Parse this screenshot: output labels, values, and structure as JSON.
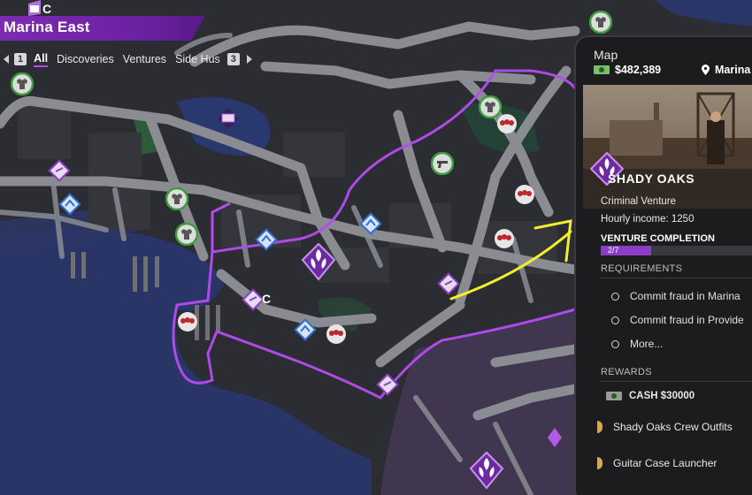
{
  "header": {
    "region_name": "Marina East",
    "logo_letter": "C"
  },
  "filters": {
    "left_key": "1",
    "tabs": [
      "All",
      "Discoveries",
      "Ventures",
      "Side Hus"
    ],
    "right_key": "3"
  },
  "map_labels": {
    "property_letter": "C"
  },
  "panel": {
    "title": "Map",
    "cash": "$482,389",
    "location": "Marina",
    "venture_name": "SHADY OAKS",
    "venture_type": "Criminal Venture",
    "hourly_income": "Hourly income: 1250",
    "completion_label": "VENTURE COMPLETION",
    "completion_text": "2/7",
    "completion_fraction": 0.2857,
    "requirements_header": "REQUIREMENTS",
    "requirements": [
      "Commit fraud in Marina",
      "Commit fraud in Provide",
      "More..."
    ],
    "rewards_header": "REWARDS",
    "reward_cash": "CASH $30000",
    "rewards": [
      "Shady Oaks Crew Outfits",
      "Guitar Case Launcher"
    ]
  },
  "colors": {
    "accent_purple": "#a23de0",
    "annotation_yellow": "#f4ef2a",
    "map_road": "#8a8c92",
    "water": "#2b3a6e"
  }
}
